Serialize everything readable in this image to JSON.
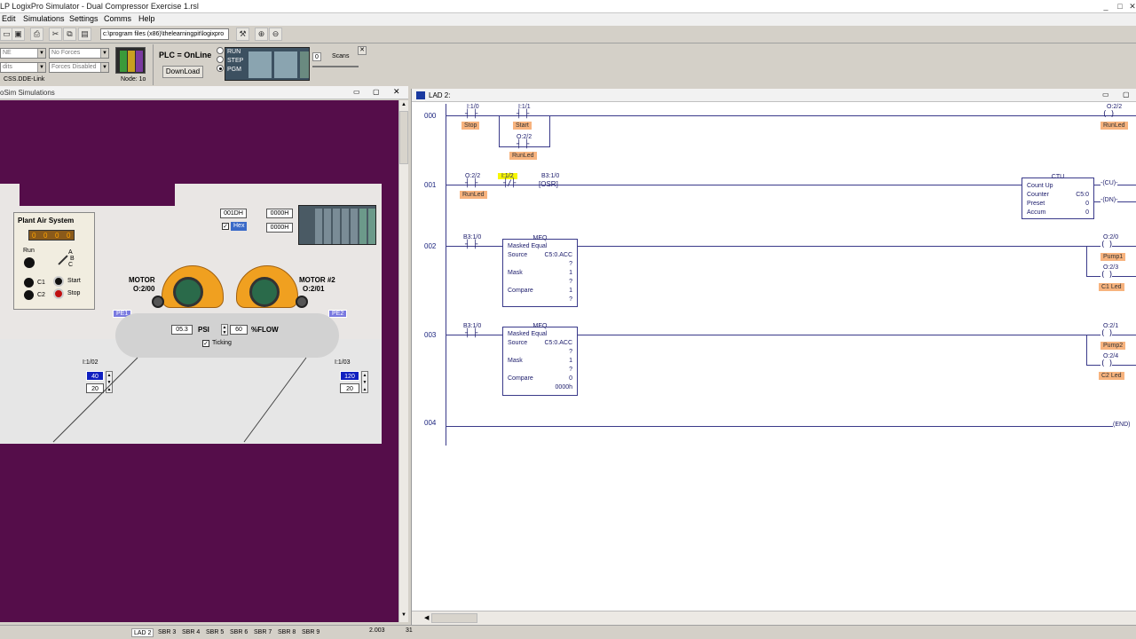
{
  "app": {
    "title": "LP LogixPro Simulator  -  Dual Compressor Exercise 1.rsl",
    "window_buttons": [
      "_",
      "□",
      "✕"
    ]
  },
  "menu": [
    "Edit",
    "Simulations",
    "Settings",
    "Comms",
    "Help"
  ],
  "toolbar": {
    "path": "c:\\program files (x86)\\thelearningpit\\logixpro",
    "buttons": [
      "new",
      "save",
      "print",
      "cut",
      "copy",
      "paste",
      "tool",
      "zoom-in",
      "zoom-out"
    ]
  },
  "controls": {
    "mode_combo": "NE",
    "forces_combo": "No Forces",
    "edits_combo": "dits",
    "forces_disabled": "Forces Disabled",
    "driver": "CSS.DDE-Link",
    "node": "Node: 1o",
    "plc_status": "PLC = OnLine",
    "download": "DownLoad",
    "modes": [
      "RUN",
      "STEP",
      "PGM"
    ],
    "scans_value": "0",
    "scans_label": "Scans"
  },
  "sim_window": {
    "title": "oSim Simulations",
    "plant_panel": {
      "title": "Plant Air System",
      "counter": [
        "0",
        "0",
        "0",
        "0"
      ],
      "run_label": "Run",
      "abc": [
        "A",
        "B",
        "C"
      ],
      "c1": "C1",
      "c2": "C2",
      "start": "Start",
      "stop": "Stop"
    },
    "hex": {
      "val1": "001DH",
      "val2": "0000H",
      "val3": "0000H",
      "hex_label": "Hex",
      "hex_checked": true
    },
    "motor1": {
      "label": "MOTOR",
      "addr": "O:2/00"
    },
    "motor2": {
      "label": "MOTOR #2",
      "addr": "O:2/01"
    },
    "pe1": "PE1",
    "pe2": "PE2",
    "psi_value": "05.3",
    "psi_label": "PSI",
    "flow_value": "60",
    "flow_label": "%FLOW",
    "ticking_label": "Ticking",
    "i102": {
      "addr": "I:1/02",
      "v1": "40",
      "v2": "20"
    },
    "i103": {
      "addr": "I:1/03",
      "v1": "120",
      "v2": "20"
    }
  },
  "lad_window": {
    "title": "LAD 2:",
    "rungs": [
      {
        "num": "000",
        "elements": [
          {
            "addr": "I:1/0",
            "label": "Stop"
          },
          {
            "addr": "I:1/1",
            "label": "Start"
          },
          {
            "addr": "O:2/2",
            "label": "RunLed"
          },
          {
            "addr": "O:2/2",
            "label": "RunLed",
            "coil": true
          }
        ]
      },
      {
        "num": "001",
        "elements": [
          {
            "addr": "O:2/2",
            "label": "RunLed"
          },
          {
            "addr": "I:1/2"
          },
          {
            "addr": "B3:1/0",
            "text": "OSR"
          }
        ],
        "ctu": {
          "title": "CTU",
          "name": "Count Up",
          "counter_label": "Counter",
          "counter": "C5:0",
          "preset_label": "Preset",
          "preset": "0",
          "accum_label": "Accum",
          "accum": "0",
          "cu": "CU",
          "dn": "DN"
        }
      },
      {
        "num": "002",
        "elements": [
          {
            "addr": "B3:1/0"
          }
        ],
        "meq": {
          "title": "MEQ",
          "name": "Masked Equal",
          "source_label": "Source",
          "source": "C5:0.ACC",
          "source_q": "?",
          "mask_label": "Mask",
          "mask": "1",
          "mask_q": "?",
          "compare_label": "Compare",
          "compare": "1",
          "compare_q": "?"
        },
        "outputs": [
          {
            "addr": "O:2/0",
            "label": "Pump1"
          },
          {
            "addr": "O:2/3",
            "label": "C1 Led"
          }
        ]
      },
      {
        "num": "003",
        "elements": [
          {
            "addr": "B3:1/0"
          }
        ],
        "meq": {
          "title": "MEQ",
          "name": "Masked Equal",
          "source_label": "Source",
          "source": "C5:0.ACC",
          "source_q": "?",
          "mask_label": "Mask",
          "mask": "1",
          "mask_q": "?",
          "compare_label": "Compare",
          "compare": "0",
          "compare_q": "0000h"
        },
        "outputs": [
          {
            "addr": "O:2/1",
            "label": "Pump2"
          },
          {
            "addr": "O:2/4",
            "label": "C2 Led"
          }
        ]
      },
      {
        "num": "004",
        "end": "END"
      }
    ]
  },
  "statusbar": {
    "tabs": [
      "LAD 2",
      "SBR 3",
      "SBR 4",
      "SBR 5",
      "SBR 6",
      "SBR 7",
      "SBR 8",
      "SBR 9"
    ],
    "file": "2.003",
    "count": "31"
  }
}
